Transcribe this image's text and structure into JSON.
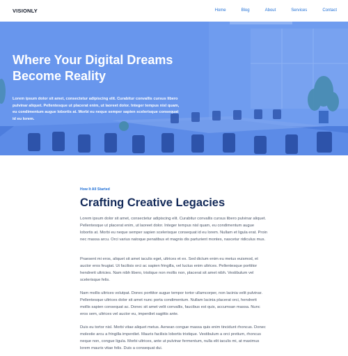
{
  "nav": {
    "logo": "VISIONLY",
    "items": [
      "Home",
      "Blog",
      "About",
      "Services",
      "Contact"
    ]
  },
  "hero": {
    "title": "Where Your Digital Dreams Become Reality",
    "text": "Lorem ipsum dolor sit amet, consectetur adipiscing elit. Curabitur convallis cursus libero pulvinar aliquet. Pellentesque ut placerat enim, ut laoreet dolor. Integer tempus nisl quam, eu condimentum augue lobortis at. Morbi eu neque semper sapien scelerisque consequat id eu lorem."
  },
  "section": {
    "kicker": "How It All Started",
    "heading": "Crafting Creative Legacies",
    "paragraphs": [
      "Lorem ipsum dolor sit amet, consectetur adipiscing elit. Curabitur convallis cursus libero pulvinar aliquet. Pellentesque ut placerat enim, ut laoreet dolor. Integer tempus nisl quam, eu condimentum augue lobortis at. Morbi eu neque semper sapien scelerisque consequat id eu lorem. Nullam et ligula erat. Proin nec massa arcu. Orci varius natoque penatibus et magnis dis parturient montes, nascetur ridiculus mus.",
      "Praesent mi eros, aliquet sit amet iaculis eget, ultrices et ex. Sed dictum enim eu metus euismod, et auctor eros feugiat. Ut facilisis orci ac sapien fringilla, vel luctus enim ultrices. Pellentesque porttitor hendrerit ultricies. Nam nibh libero, tristique non mollis non, placerat sit amet nibh. Vestibulum vel scelerisque felis.",
      "Nam mollis ultrices volutpat. Donec porttitor augue tempor tortor ullamcorper, non lacinia velit pulvinar. Pellentesque ultrices dolor sit amet nunc porta condimentum. Nullam lacinia placerat orci, hendrerit mollis sapien consequat ac. Donec sit amet velit convallis, faucibus est quis, accumsan massa. Nunc eros sem, ultrices vel auctor eu, imperdiet sagittis ante.",
      "Duis eu tortor nisl. Morbi vitae aliquet metus. Aenean congue massa quis enim tincidunt rhoncus. Donec molestie arcu a fringilla imperdiet. Mauris facilisis lobortis tristique. Vestibulum a orci pretium, rhoncus neque non, congue ligula. Morbi ultrices, ante ut pulvinar fermentum, nulla elit iaculis mi, at maximus lorem mauris vitae felis. Duis a consequat dui."
    ]
  },
  "colors": {
    "accent": "#1f6fd6",
    "heading": "#132a59",
    "hero_overlay": "#5f8feb"
  }
}
